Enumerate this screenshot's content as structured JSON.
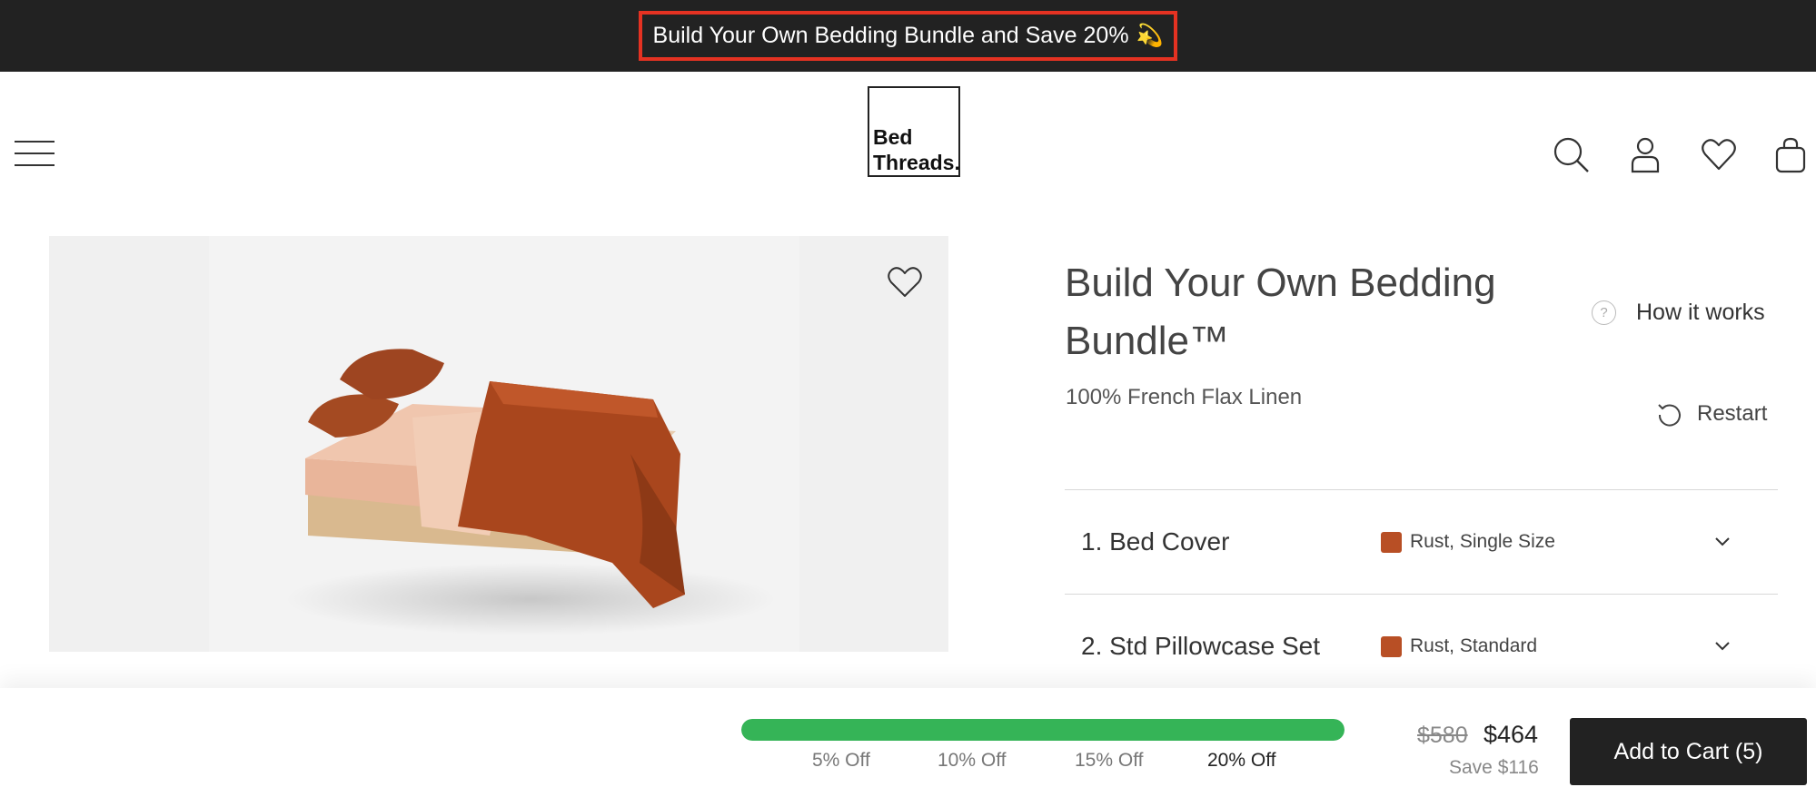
{
  "announcement": {
    "text": "Build Your Own Bedding Bundle and Save 20%",
    "emoji": "💫"
  },
  "header": {
    "logo_line1": "Bed",
    "logo_line2": "Threads.",
    "icons": [
      "menu-icon",
      "search-icon",
      "account-icon",
      "wishlist-icon",
      "cart-icon"
    ]
  },
  "product": {
    "title": "Build Your Own Bedding Bundle™",
    "subtitle": "100% French Flax Linen",
    "how_it_works": "How it works",
    "restart": "Restart",
    "items": [
      {
        "label": "1. Bed Cover",
        "value": "Rust, Single Size",
        "swatch": "#b84f25"
      },
      {
        "label": "2. Std Pillowcase Set",
        "value": "Rust, Standard",
        "swatch": "#b84f25"
      }
    ]
  },
  "bundle_bar": {
    "progress_percent": 100,
    "tiers": [
      "5% Off",
      "10% Off",
      "15% Off",
      "20% Off"
    ],
    "active_tier": "20% Off",
    "old_price": "$580",
    "new_price": "$464",
    "savings": "Save $116",
    "add_to_cart": "Add to Cart (5)"
  },
  "colors": {
    "accent_green": "#35b457",
    "rust": "#b84f25",
    "dark": "#222222",
    "highlight": "#e53222"
  }
}
